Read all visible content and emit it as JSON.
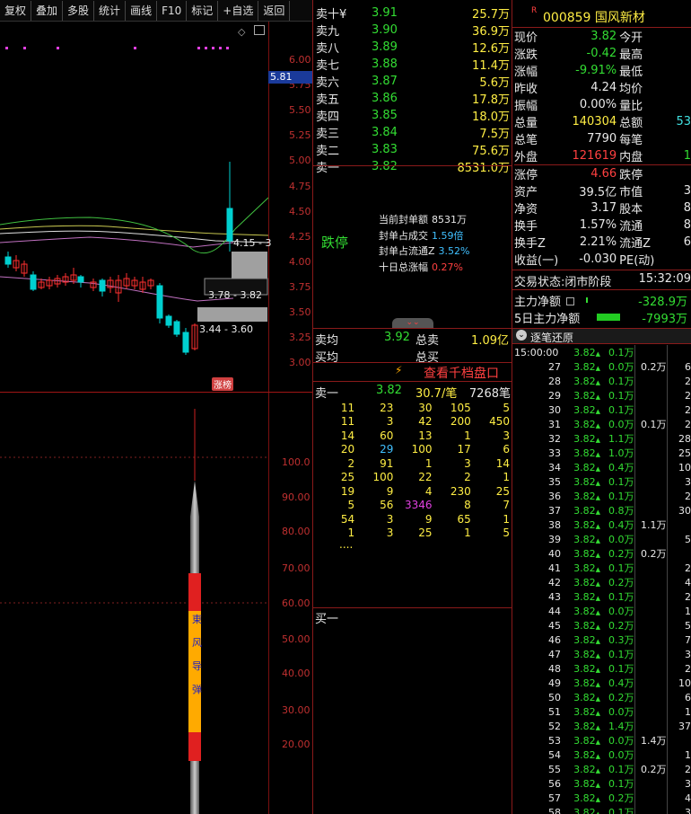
{
  "toolbar": {
    "items": [
      "复权",
      "叠加",
      "多股",
      "统计",
      "画线",
      "F10",
      "标记",
      "+自选",
      "返回"
    ]
  },
  "chart": {
    "price_axis": [
      "6.00",
      "5.75",
      "5.50",
      "5.25",
      "5.00",
      "4.75",
      "4.50",
      "4.25",
      "4.00",
      "3.75",
      "3.50",
      "3.25",
      "3.00"
    ],
    "cur_price_label": "5.81",
    "band_labels": [
      "4.15 - 3",
      "3.78 - 3.82",
      "3.44 - 3.60"
    ],
    "tag": "涨榜",
    "vol_axis": [
      "100.0",
      "90.00",
      "80.00",
      "70.00",
      "60.00",
      "50.00",
      "40.00",
      "30.00",
      "20.00"
    ],
    "rocket_chars": [
      "東",
      "风",
      "导",
      "弹"
    ]
  },
  "sell_book": [
    {
      "label": "卖十¥",
      "price": "3.91",
      "vol": "25.7万"
    },
    {
      "label": "卖九",
      "price": "3.90",
      "vol": "36.9万"
    },
    {
      "label": "卖八",
      "price": "3.89",
      "vol": "12.6万"
    },
    {
      "label": "卖七",
      "price": "3.88",
      "vol": "11.4万"
    },
    {
      "label": "卖六",
      "price": "3.87",
      "vol": "5.6万"
    },
    {
      "label": "卖五",
      "price": "3.86",
      "vol": "17.8万"
    },
    {
      "label": "卖四",
      "price": "3.85",
      "vol": "18.0万"
    },
    {
      "label": "卖三",
      "price": "3.84",
      "vol": "7.5万"
    },
    {
      "label": "卖二",
      "price": "3.83",
      "vol": "75.6万"
    },
    {
      "label": "卖一",
      "price": "3.82",
      "vol": "8531.0万"
    }
  ],
  "limit": {
    "status": "跌停",
    "rows": [
      {
        "k": "当前封单额",
        "v": "8531万"
      },
      {
        "k": "封单占成交",
        "v": "1.59倍"
      },
      {
        "k": "封单占流通Z",
        "v": "3.52%"
      },
      {
        "k": "十日总涨幅",
        "v": "0.27%"
      }
    ]
  },
  "avg": {
    "sell_avg_label": "卖均",
    "sell_avg": "3.92",
    "total_sell_label": "总卖",
    "total_sell": "1.09亿",
    "buy_avg_label": "买均",
    "total_buy_label": "总买"
  },
  "deep": {
    "link": "查看千档盘口",
    "head": {
      "label": "卖一",
      "price": "3.82",
      "vol": "30.7/笔",
      "count": "7268笔"
    },
    "rows": [
      [
        "11",
        "23",
        "30",
        "105",
        "5"
      ],
      [
        "11",
        "3",
        "42",
        "200",
        "450"
      ],
      [
        "14",
        "60",
        "13",
        "1",
        "3"
      ],
      [
        "20",
        "29",
        "100",
        "17",
        "6"
      ],
      [
        "2",
        "91",
        "1",
        "3",
        "14"
      ],
      [
        "25",
        "100",
        "22",
        "2",
        "1"
      ],
      [
        "19",
        "9",
        "4",
        "230",
        "25"
      ],
      [
        "5",
        "56",
        "3346",
        "8",
        "7"
      ],
      [
        "54",
        "3",
        "9",
        "65",
        "1"
      ],
      [
        "1",
        "3",
        "25",
        "1",
        "5"
      ]
    ],
    "more": "....",
    "buy1": "买一"
  },
  "stock": {
    "code": "000859",
    "name": "国风新材",
    "r": "R"
  },
  "stats": [
    {
      "a": "现价",
      "b": "3.82",
      "c": "今开",
      "d": ""
    },
    {
      "a": "涨跌",
      "b": "-0.42",
      "c": "最高",
      "d": ""
    },
    {
      "a": "涨幅",
      "b": "-9.91%",
      "c": "最低",
      "d": ""
    },
    {
      "a": "昨收",
      "b": "4.24",
      "c": "均价",
      "d": ""
    },
    {
      "a": "振幅",
      "b": "0.00%",
      "c": "量比",
      "d": ""
    },
    {
      "a": "总量",
      "b": "140304",
      "c": "总额",
      "d": "53"
    },
    {
      "a": "总笔",
      "b": "7790",
      "c": "每笔",
      "d": ""
    },
    {
      "a": "外盘",
      "b": "121619",
      "c": "内盘",
      "d": "1"
    },
    {
      "a": "涨停",
      "b": "4.66",
      "c": "跌停",
      "d": ""
    },
    {
      "a": "资产",
      "b": "39.5亿",
      "c": "市值",
      "d": "3"
    },
    {
      "a": "净资",
      "b": "3.17",
      "c": "股本",
      "d": "8"
    },
    {
      "a": "换手",
      "b": "1.57%",
      "c": "流通",
      "d": "8"
    },
    {
      "a": "换手Z",
      "b": "2.21%",
      "c": "流通Z",
      "d": "6"
    },
    {
      "a": "收益(一)",
      "b": "-0.030",
      "c": "PE(动)",
      "d": ""
    }
  ],
  "trade": {
    "label": "交易状态:",
    "phase": "闭市阶段",
    "time": "15:32:09"
  },
  "flow": [
    {
      "label": "主力净额",
      "value": "-328.9万"
    },
    {
      "label": "5日主力净额",
      "value": "-7993万"
    }
  ],
  "tick_title": "逐笔还原",
  "ticks": [
    {
      "t": "15:00:00",
      "p": "3.82",
      "v": "0.1万",
      "g": "",
      "c": ""
    },
    {
      "t": "27",
      "p": "3.82",
      "v": "0.0万",
      "g": "0.2万",
      "c": "6"
    },
    {
      "t": "28",
      "p": "3.82",
      "v": "0.1万",
      "g": "",
      "c": "2"
    },
    {
      "t": "29",
      "p": "3.82",
      "v": "0.1万",
      "g": "",
      "c": "2"
    },
    {
      "t": "30",
      "p": "3.82",
      "v": "0.1万",
      "g": "",
      "c": "2"
    },
    {
      "t": "31",
      "p": "3.82",
      "v": "0.0万",
      "g": "0.1万",
      "c": "2"
    },
    {
      "t": "32",
      "p": "3.82",
      "v": "1.1万",
      "g": "",
      "c": "28"
    },
    {
      "t": "33",
      "p": "3.82",
      "v": "1.0万",
      "g": "",
      "c": "25"
    },
    {
      "t": "34",
      "p": "3.82",
      "v": "0.4万",
      "g": "",
      "c": "10"
    },
    {
      "t": "35",
      "p": "3.82",
      "v": "0.1万",
      "g": "",
      "c": "3"
    },
    {
      "t": "36",
      "p": "3.82",
      "v": "0.1万",
      "g": "",
      "c": "2"
    },
    {
      "t": "37",
      "p": "3.82",
      "v": "0.8万",
      "g": "",
      "c": "30"
    },
    {
      "t": "38",
      "p": "3.82",
      "v": "0.4万",
      "g": "1.1万",
      "c": ""
    },
    {
      "t": "39",
      "p": "3.82",
      "v": "0.0万",
      "g": "",
      "c": "5"
    },
    {
      "t": "40",
      "p": "3.82",
      "v": "0.2万",
      "g": "0.2万",
      "c": ""
    },
    {
      "t": "41",
      "p": "3.82",
      "v": "0.1万",
      "g": "",
      "c": "2"
    },
    {
      "t": "42",
      "p": "3.82",
      "v": "0.2万",
      "g": "",
      "c": "4"
    },
    {
      "t": "43",
      "p": "3.82",
      "v": "0.1万",
      "g": "",
      "c": "2"
    },
    {
      "t": "44",
      "p": "3.82",
      "v": "0.0万",
      "g": "",
      "c": "1"
    },
    {
      "t": "45",
      "p": "3.82",
      "v": "0.2万",
      "g": "",
      "c": "5"
    },
    {
      "t": "46",
      "p": "3.82",
      "v": "0.3万",
      "g": "",
      "c": "7"
    },
    {
      "t": "47",
      "p": "3.82",
      "v": "0.1万",
      "g": "",
      "c": "3"
    },
    {
      "t": "48",
      "p": "3.82",
      "v": "0.1万",
      "g": "",
      "c": "2"
    },
    {
      "t": "49",
      "p": "3.82",
      "v": "0.4万",
      "g": "",
      "c": "10"
    },
    {
      "t": "50",
      "p": "3.82",
      "v": "0.2万",
      "g": "",
      "c": "6"
    },
    {
      "t": "51",
      "p": "3.82",
      "v": "0.0万",
      "g": "",
      "c": "1"
    },
    {
      "t": "52",
      "p": "3.82",
      "v": "1.4万",
      "g": "",
      "c": "37"
    },
    {
      "t": "53",
      "p": "3.82",
      "v": "0.0万",
      "g": "1.4万",
      "c": ""
    },
    {
      "t": "54",
      "p": "3.82",
      "v": "0.0万",
      "g": "",
      "c": "1"
    },
    {
      "t": "55",
      "p": "3.82",
      "v": "0.1万",
      "g": "0.2万",
      "c": "2"
    },
    {
      "t": "56",
      "p": "3.82",
      "v": "0.1万",
      "g": "",
      "c": "3"
    },
    {
      "t": "57",
      "p": "3.82",
      "v": "0.2万",
      "g": "",
      "c": "4"
    },
    {
      "t": "58",
      "p": "3.82",
      "v": "0.1万",
      "g": "",
      "c": "3"
    }
  ]
}
